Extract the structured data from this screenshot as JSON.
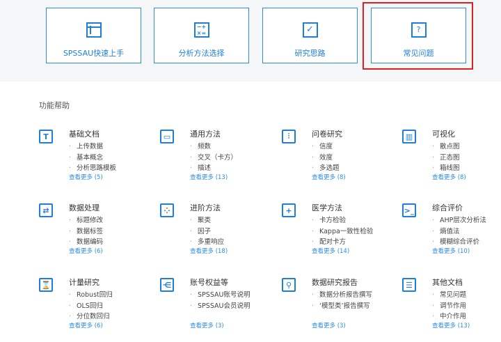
{
  "cards": [
    {
      "label": "SPSSAU快速上手",
      "icon": "layout-icon"
    },
    {
      "label": "分析方法选择",
      "icon": "calculator-icon"
    },
    {
      "label": "研究思路",
      "icon": "checkbox-icon"
    },
    {
      "label": "常见问题",
      "icon": "question-icon"
    }
  ],
  "section_title": "功能帮助",
  "categories": [
    {
      "title": "基础文档",
      "glyph": "T",
      "items": [
        "上传数据",
        "基本概念",
        "分析思路模板"
      ],
      "more": "查看更多 (5)"
    },
    {
      "title": "通用方法",
      "glyph": "▭",
      "items": [
        "频数",
        "交叉（卡方）",
        "描述"
      ],
      "more": "查看更多 (13)"
    },
    {
      "title": "问卷研究",
      "glyph": "⫶",
      "items": [
        "信度",
        "效度",
        "多选题"
      ],
      "more": "查看更多 (8)"
    },
    {
      "title": "可视化",
      "glyph": "▥",
      "items": [
        "散点图",
        "正态图",
        "箱线图"
      ],
      "more": "查看更多 (8)"
    },
    {
      "title": "数据处理",
      "glyph": "⇄",
      "items": [
        "标题修改",
        "数据标签",
        "数据编码"
      ],
      "more": "查看更多 (6)"
    },
    {
      "title": "进阶方法",
      "glyph": "⁘",
      "items": [
        "聚类",
        "因子",
        "多重响应"
      ],
      "more": "查看更多 (18)"
    },
    {
      "title": "医学方法",
      "glyph": "+",
      "items": [
        "卡方检验",
        "Kappa一致性检验",
        "配对卡方"
      ],
      "more": "查看更多 (14)"
    },
    {
      "title": "综合评价",
      "glyph": ">_",
      "items": [
        "AHP层次分析法",
        "熵值法",
        "模糊综合评价"
      ],
      "more": "查看更多 (10)"
    },
    {
      "title": "计量研究",
      "glyph": "⌛",
      "items": [
        "Robust回归",
        "OLS回归",
        "分位数回归"
      ],
      "more": "查看更多 (6)"
    },
    {
      "title": "账号权益等",
      "glyph": "⋲",
      "items": [
        "SPSSAU账号说明",
        "SPSSAU会员说明"
      ],
      "more": "查看更多 (3)"
    },
    {
      "title": "数据研究报告",
      "glyph": "⚲",
      "items": [
        "数据分析报告撰写",
        "‘模型类’报告撰写"
      ],
      "more": "查看更多 (3)"
    },
    {
      "title": "其他文档",
      "glyph": "☰",
      "items": [
        "常见问题",
        "调节作用",
        "中介作用"
      ],
      "more": "查看更多 (13)"
    }
  ]
}
